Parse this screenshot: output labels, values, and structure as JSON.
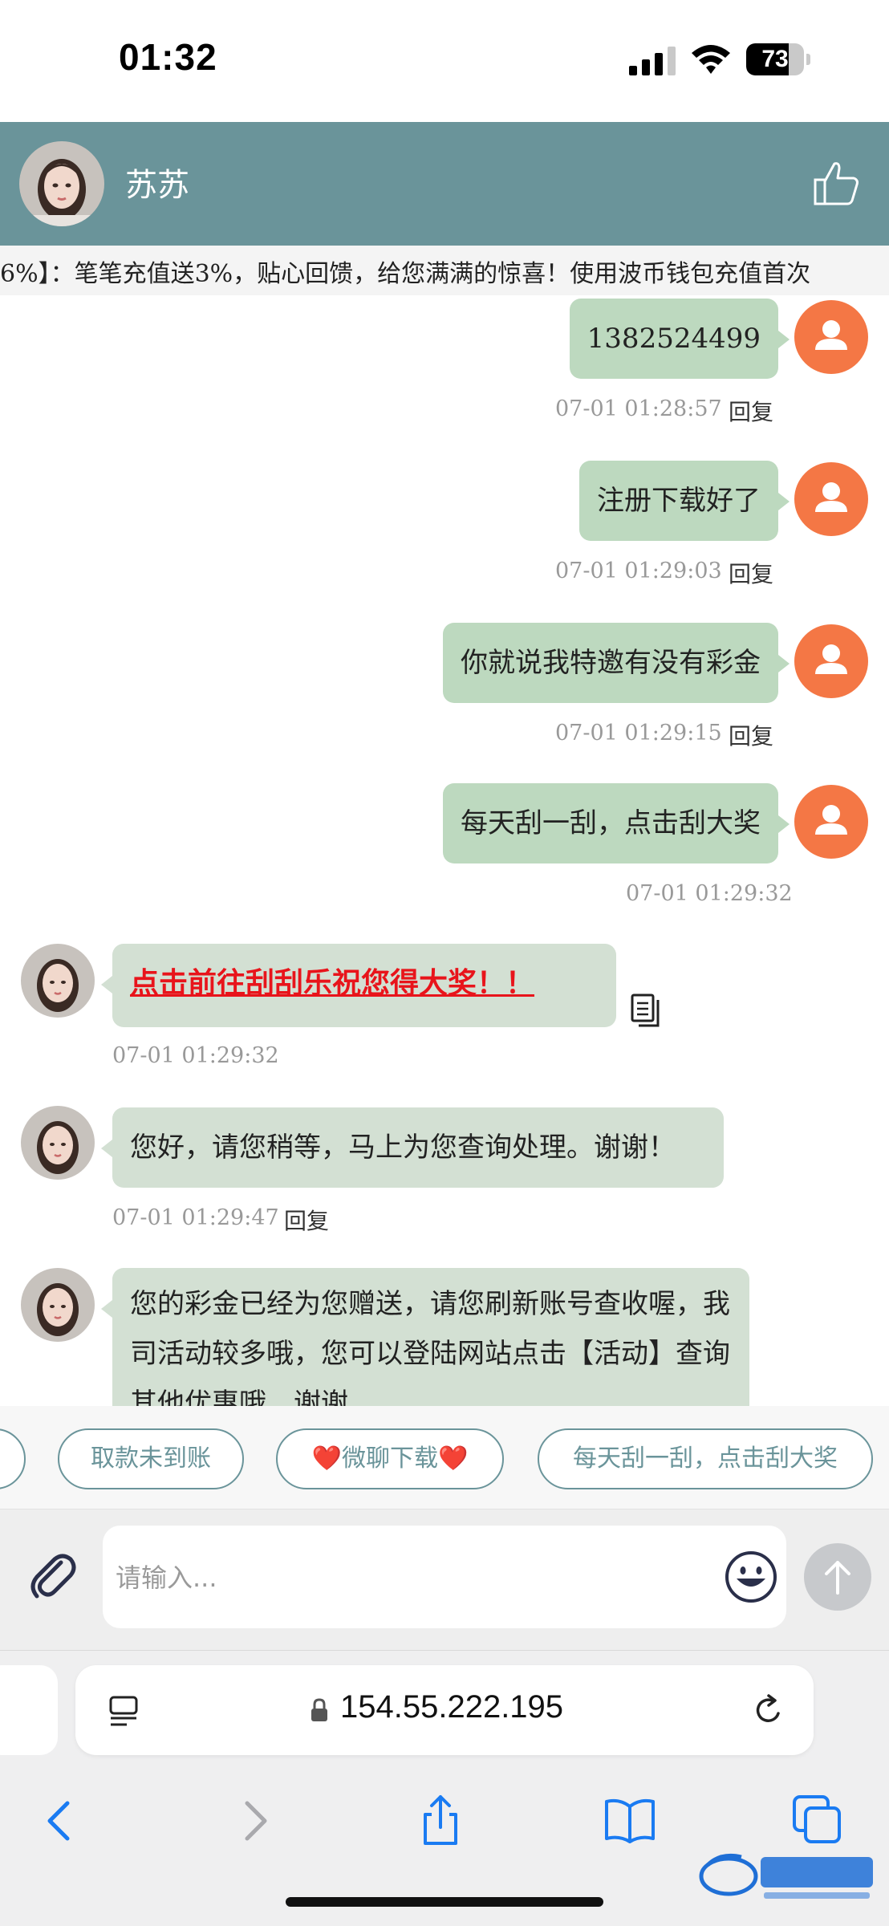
{
  "status_bar": {
    "time": "01:32",
    "battery": "73",
    "battery_level_percent": 73
  },
  "header": {
    "name": "苏苏"
  },
  "marquee": {
    "text": "6%】：笔笔充值送3%，贴心回馈，给您满满的惊喜！使用波币钱包充值首次"
  },
  "messages": [
    {
      "side": "right",
      "text": "1382524499",
      "time": "07-01 01:28:57",
      "reply": "回复"
    },
    {
      "side": "right",
      "text": "注册下载好了",
      "time": "07-01 01:29:03",
      "reply": "回复"
    },
    {
      "side": "right",
      "text": "你就说我特邀有没有彩金",
      "time": "07-01 01:29:15",
      "reply": "回复"
    },
    {
      "side": "right",
      "text": "每天刮一刮，点击刮大奖",
      "time": "07-01 01:29:32"
    },
    {
      "side": "left",
      "text": "点击前往刮刮乐祝您得大奖！！",
      "time": "07-01 01:29:32",
      "is_link": true
    },
    {
      "side": "left",
      "text": "您好，请您稍等，马上为您查询处理。谢谢！",
      "time": "07-01 01:29:47",
      "reply": "回复"
    },
    {
      "side": "left",
      "text": "您的彩金已经为您赠送，请您刷新账号查收喔，我司活动较多哦，您可以登陆网站点击【活动】查询其他优惠哦，谢谢"
    }
  ],
  "quick_replies": [
    "取款未到账",
    "❤️微聊下载❤️",
    "每天刮一刮，点击刮大奖"
  ],
  "input": {
    "placeholder": "请输入..."
  },
  "browser": {
    "url": "154.55.222.195"
  },
  "colors": {
    "header_bg": "#6a949a",
    "bubble_user": "#bdd9bf",
    "bubble_agent": "#d3e0d3",
    "user_avatar": "#f47745",
    "link_red": "#e8141b"
  }
}
